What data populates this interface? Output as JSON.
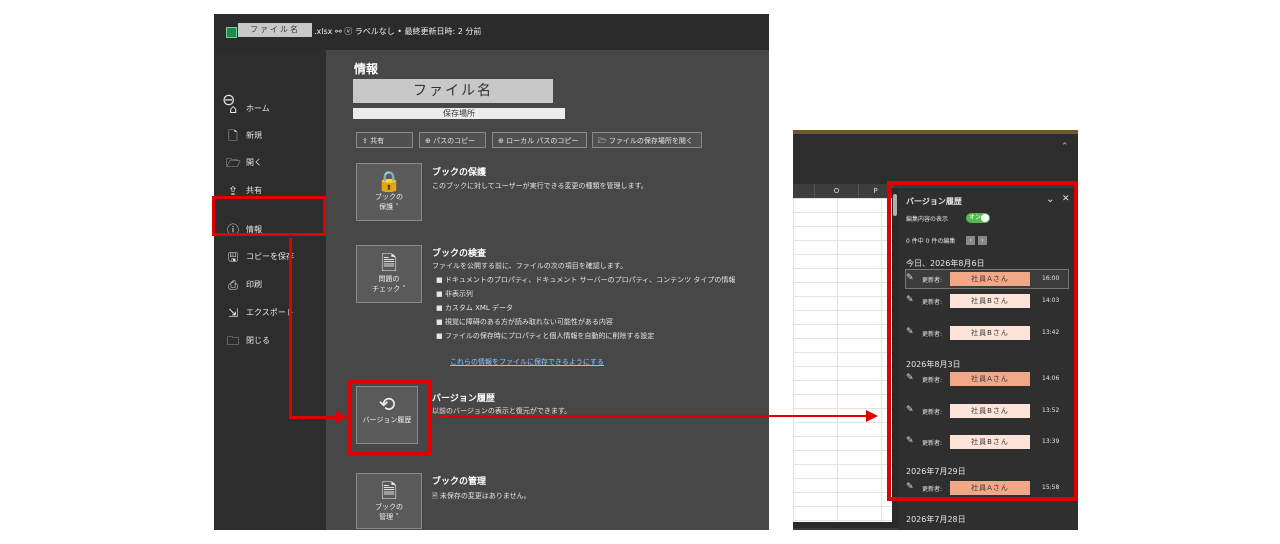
{
  "titlebar": {
    "filename": "ファイル名",
    "rest": ".xlsx ⚯ ⓥ ラベルなし • 最終更新日時: 2 分前"
  },
  "nav": {
    "back": "⊖",
    "items": [
      {
        "icon": "⌂",
        "label": "ホーム"
      },
      {
        "icon": "🗋",
        "label": "新規"
      },
      {
        "icon": "🗁",
        "label": "開く"
      },
      {
        "icon": "⇪",
        "label": "共有"
      },
      {
        "icon": "ⓘ",
        "label": "情報"
      },
      {
        "icon": "🖫",
        "label": "コピーを保存"
      },
      {
        "icon": "⎙",
        "label": "印刷"
      },
      {
        "icon": "⇲",
        "label": "エクスポート"
      },
      {
        "icon": "🗀",
        "label": "閉じる"
      }
    ]
  },
  "info": {
    "title": "情報",
    "file_name": "ファイル名",
    "location": "保存場所",
    "toolbar": [
      "⇪ 共有",
      "⊕ パスのコピー",
      "⊕ ローカル パスのコピー",
      "🗁 ファイルの保存場所を開く"
    ],
    "protect": {
      "button": "ブックの\n保護 ˅",
      "title": "ブックの保護",
      "desc": "このブックに対してユーザーが実行できる変更の種類を管理します。"
    },
    "inspect": {
      "button": "問題の\nチェック ˅",
      "title": "ブックの検査",
      "desc": "ファイルを公開する前に、ファイルの次の項目を確認します。",
      "bullets": [
        "■  ドキュメントのプロパティ、ドキュメント サーバーのプロパティ、コンテンツ タイプの情報",
        "■  非表示列",
        "■  カスタム XML データ",
        "■  視覚に障碍のある方が読み取れない可能性がある内容",
        "■  ファイルの保存時にプロパティと個人情報を自動的に削除する設定"
      ],
      "link": "これらの情報をファイルに保存できるようにする"
    },
    "version": {
      "button": "バージョン履歴",
      "title": "バージョン履歴",
      "desc": "以前のバージョンの表示と復元ができます。"
    },
    "manage": {
      "button": "ブックの\n管理 ˅",
      "title": "ブックの管理",
      "desc": "🗎  未保存の変更はありません。"
    }
  },
  "sheet": {
    "columns": [
      "",
      "O",
      "P"
    ]
  },
  "panel": {
    "title": "バージョン履歴",
    "chevron": "⌄",
    "close": "✕",
    "show_edits": "編集内容の表示",
    "toggle": "オン",
    "edit_count": "0 件中 0 件の編集",
    "groups": [
      {
        "date": "今日、2026年8月6日",
        "rows": [
          {
            "by": "更新者:",
            "name": "社員Aさん",
            "time": "16:00",
            "color": "#f0a888",
            "selected": true
          },
          {
            "by": "更新者:",
            "name": "社員Bさん",
            "time": "14:03",
            "color": "#fde3d8"
          },
          {
            "by": "更新者:",
            "name": "社員Bさん",
            "time": "13:42",
            "color": "#fde3d8"
          }
        ]
      },
      {
        "date": "2026年8月3日",
        "rows": [
          {
            "by": "更新者:",
            "name": "社員Aさん",
            "time": "14:06",
            "color": "#f0a888"
          },
          {
            "by": "更新者:",
            "name": "社員Bさん",
            "time": "13:52",
            "color": "#fde3d8"
          },
          {
            "by": "更新者:",
            "name": "社員Bさん",
            "time": "13:39",
            "color": "#fde3d8"
          }
        ]
      },
      {
        "date": "2026年7月29日",
        "rows": [
          {
            "by": "更新者:",
            "name": "社員Aさん",
            "time": "15:58",
            "color": "#f0a888"
          }
        ]
      },
      {
        "date": "2026年7月28日",
        "rows": []
      }
    ]
  }
}
